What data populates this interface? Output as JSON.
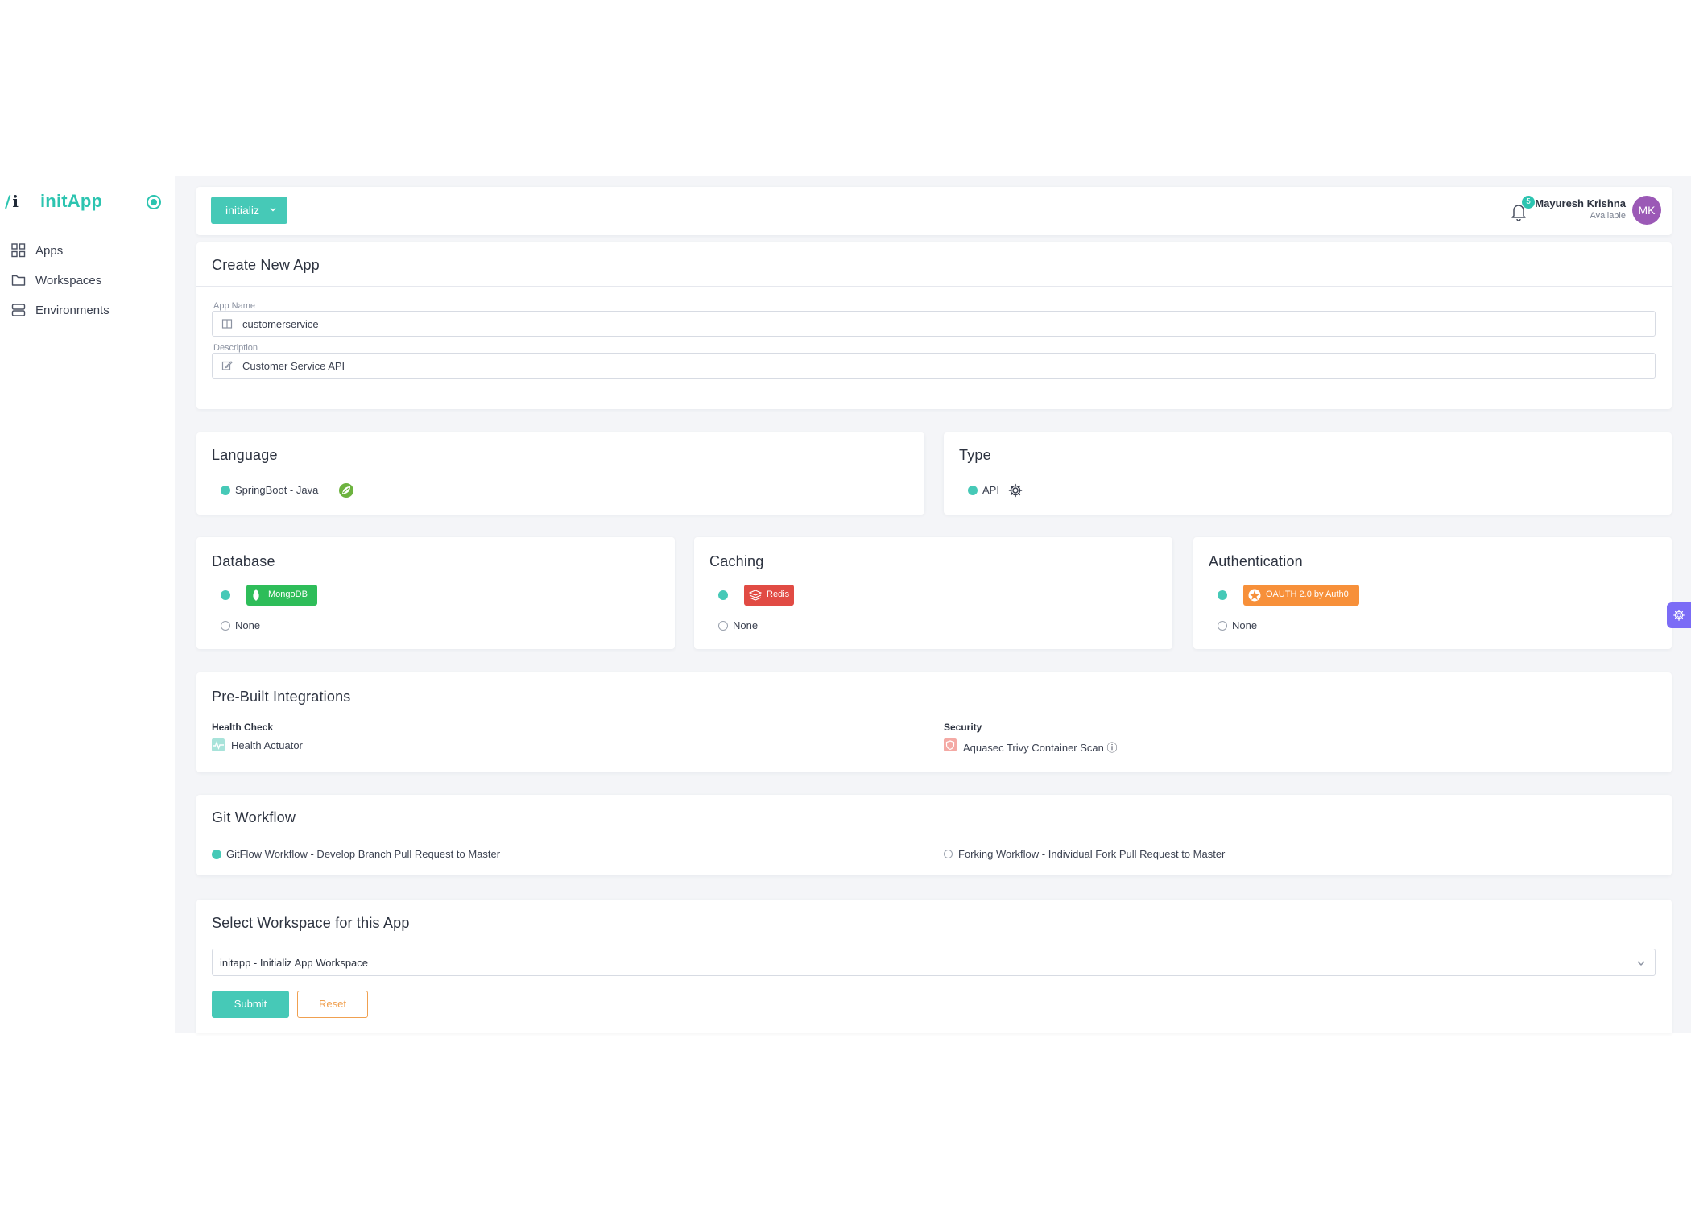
{
  "brand": {
    "mark": "/i",
    "name": "initApp"
  },
  "sidebar": {
    "items": [
      {
        "label": "Apps",
        "icon": "grid-icon"
      },
      {
        "label": "Workspaces",
        "icon": "folder-icon"
      },
      {
        "label": "Environments",
        "icon": "server-icon"
      }
    ]
  },
  "topbar": {
    "app_switch": "initializ",
    "notifications": "5",
    "user": {
      "name": "Mayuresh Krishna",
      "status": "Available",
      "initials": "MK"
    }
  },
  "create": {
    "title": "Create New App",
    "app_name_label": "App Name",
    "app_name_value": "customerservice",
    "description_label": "Description",
    "description_value": "Customer Service API"
  },
  "language": {
    "title": "Language",
    "option": "SpringBoot - Java"
  },
  "type": {
    "title": "Type",
    "option": "API"
  },
  "database": {
    "title": "Database",
    "selected": "MongoDB",
    "none": "None"
  },
  "caching": {
    "title": "Caching",
    "selected": "Redis",
    "none": "None"
  },
  "authentication": {
    "title": "Authentication",
    "selected": "OAUTH 2.0 by Auth0",
    "none": "None"
  },
  "integrations": {
    "title": "Pre-Built Integrations",
    "health_heading": "Health Check",
    "health_item": "Health Actuator",
    "security_heading": "Security",
    "security_item": "Aquasec Trivy Container Scan ⓘ"
  },
  "git": {
    "title": "Git Workflow",
    "option1": "GitFlow Workflow - Develop Branch Pull Request to Master",
    "option2": "Forking Workflow - Individual Fork Pull Request to Master"
  },
  "workspace": {
    "title": "Select Workspace for this App",
    "selected": "initapp - Initializ App Workspace",
    "submit": "Submit",
    "reset": "Reset"
  },
  "colors": {
    "accent": "#46c9b7",
    "mongodb": "#2ebd59",
    "redis": "#e14b44",
    "auth0": "#f7903a",
    "avatar": "#9b59b6",
    "settings_fab": "#7b6cf6"
  }
}
